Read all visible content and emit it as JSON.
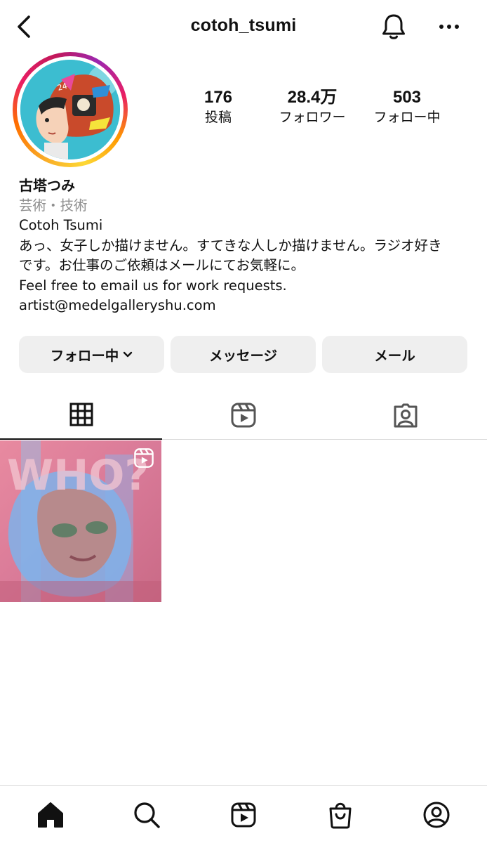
{
  "header": {
    "username": "cotoh_tsumi",
    "back_icon": "chevron-left-icon",
    "notification_icon": "bell-icon",
    "more_icon": "more-dots-icon"
  },
  "profile": {
    "stats": {
      "posts_count": "176",
      "posts_label": "投稿",
      "followers_count": "28.4万",
      "followers_label": "フォロワー",
      "following_count": "503",
      "following_label": "フォロー中"
    },
    "display_name": "古塔つみ",
    "category": "芸術・技術",
    "bio_lines": [
      "Cotoh Tsumi",
      "あっ、女子しか描けません。すてきな人しか描けません。ラジオ好き",
      "です。お仕事のご依頼はメールにてお気軽に。",
      "Feel free to email us for work requests.",
      "artist@medelgalleryshu.com"
    ]
  },
  "actions": {
    "follow_label": "フォロー中",
    "message_label": "メッセージ",
    "mail_label": "メール"
  },
  "tabs": [
    {
      "name": "grid",
      "icon": "grid-icon",
      "active": true
    },
    {
      "name": "reels",
      "icon": "reels-icon",
      "active": false
    },
    {
      "name": "tagged",
      "icon": "tagged-person-icon",
      "active": false
    }
  ],
  "posts": [
    {
      "type": "reel",
      "badge_icon": "reels-icon"
    }
  ],
  "bottom_nav": [
    "home-icon",
    "search-icon",
    "reels-icon",
    "shop-icon",
    "profile-icon"
  ],
  "colors": {
    "text": "#111111",
    "secondary_text": "#8e8e8e",
    "button_bg": "#efefef",
    "divider": "#dbdbdb"
  }
}
